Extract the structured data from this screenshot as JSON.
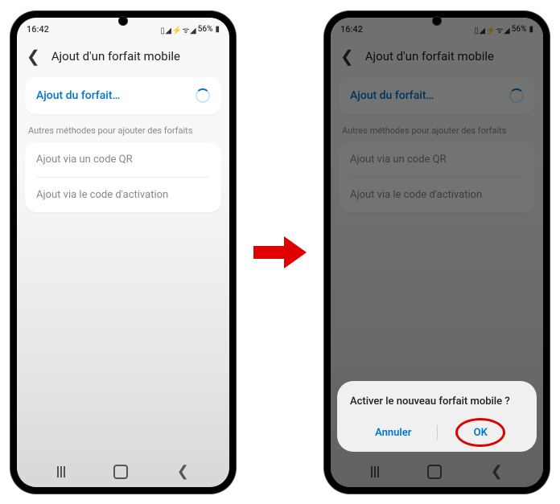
{
  "status": {
    "time": "16:42",
    "icons": "▯ ◢ ⚡ ᯤ ◢",
    "battery": "56%",
    "battery_icon": "▮"
  },
  "page": {
    "title": "Ajout d'un forfait mobile"
  },
  "primary_action": {
    "label": "Ajout du forfait…"
  },
  "section_label": "Autres méthodes pour ajouter des forfaits",
  "options": {
    "qr": "Ajout via un code QR",
    "activation": "Ajout via le code d'activation"
  },
  "dialog": {
    "title": "Activer le nouveau forfait mobile ?",
    "cancel": "Annuler",
    "ok": "OK"
  }
}
